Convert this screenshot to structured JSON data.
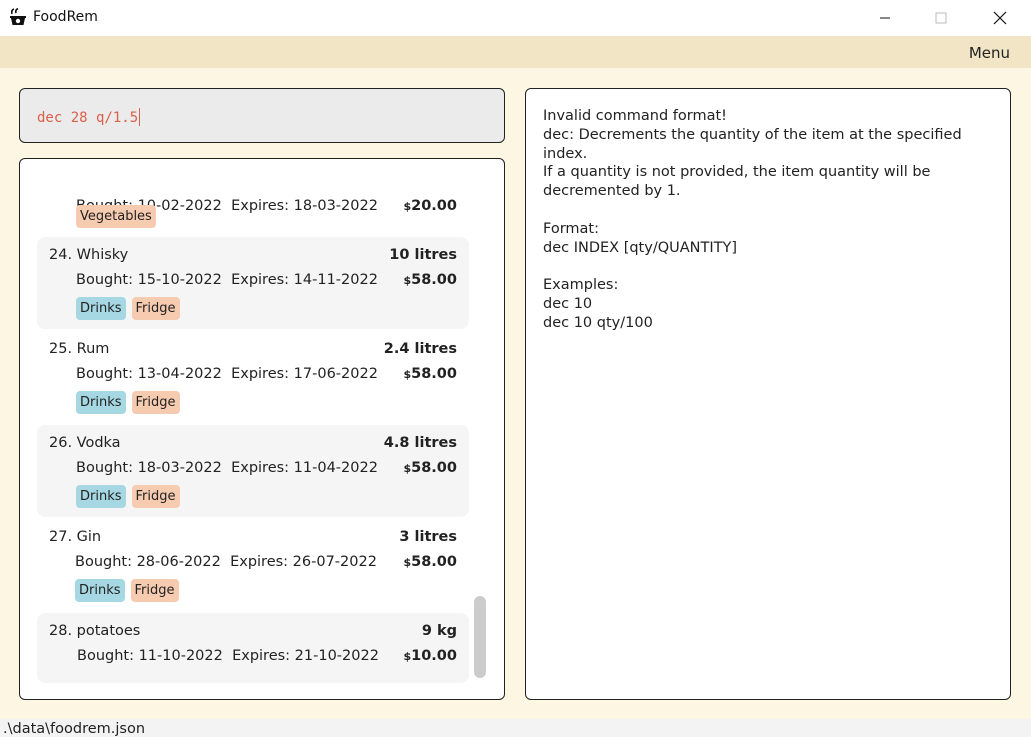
{
  "window": {
    "title": "FoodRem",
    "icon": "pot-icon",
    "controls": [
      "minimize",
      "maximize",
      "close"
    ]
  },
  "menubar": {
    "menu_label": "Menu"
  },
  "command_box": {
    "value": "dec 28 q/1.5"
  },
  "items": [
    {
      "index": "",
      "name": "",
      "quantity": "",
      "bought": "Bought: 10-02-2022",
      "expires": "Expires: 18-03-2022",
      "price": "20.00",
      "currency": "$",
      "tags": [
        "Vegetables"
      ]
    },
    {
      "index": "24.",
      "name": "Whisky",
      "quantity": "10 litres",
      "bought": "Bought: 15-10-2022",
      "expires": "Expires: 14-11-2022",
      "price": "58.00",
      "currency": "$",
      "tags": [
        "Drinks",
        "Fridge"
      ]
    },
    {
      "index": "25.",
      "name": "Rum",
      "quantity": "2.4 litres",
      "bought": "Bought: 13-04-2022",
      "expires": "Expires: 17-06-2022",
      "price": "58.00",
      "currency": "$",
      "tags": [
        "Drinks",
        "Fridge"
      ]
    },
    {
      "index": "26.",
      "name": "Vodka",
      "quantity": "4.8 litres",
      "bought": "Bought: 18-03-2022",
      "expires": "Expires: 11-04-2022",
      "price": "58.00",
      "currency": "$",
      "tags": [
        "Drinks",
        "Fridge"
      ]
    },
    {
      "index": "27.",
      "name": "Gin",
      "quantity": "3 litres",
      "bought": "Bought: 28-06-2022",
      "expires": "Expires: 26-07-2022",
      "price": "58.00",
      "currency": "$",
      "tags": [
        "Drinks",
        "Fridge"
      ]
    },
    {
      "index": "28.",
      "name": "potatoes",
      "quantity": "9 kg",
      "bought": "Bought: 11-10-2022",
      "expires": "Expires: 21-10-2022",
      "price": "10.00",
      "currency": "$",
      "tags": []
    }
  ],
  "result": {
    "text": "Invalid command format!\ndec: Decrements the quantity of the item at the specified index.\nIf a quantity is not provided, the item quantity will be decremented by 1.\n\nFormat:\ndec INDEX [qty/QUANTITY]\n\nExamples:\ndec 10\ndec 10 qty/100"
  },
  "statusbar": {
    "path": ".\\data\\foodrem.json"
  },
  "colors": {
    "menubar": "#f1e5c6",
    "background": "#fdf6e3",
    "command_text": "#d9604a",
    "tag_drinks": "#a6d8e3",
    "tag_fridge": "#f6cbb0"
  }
}
